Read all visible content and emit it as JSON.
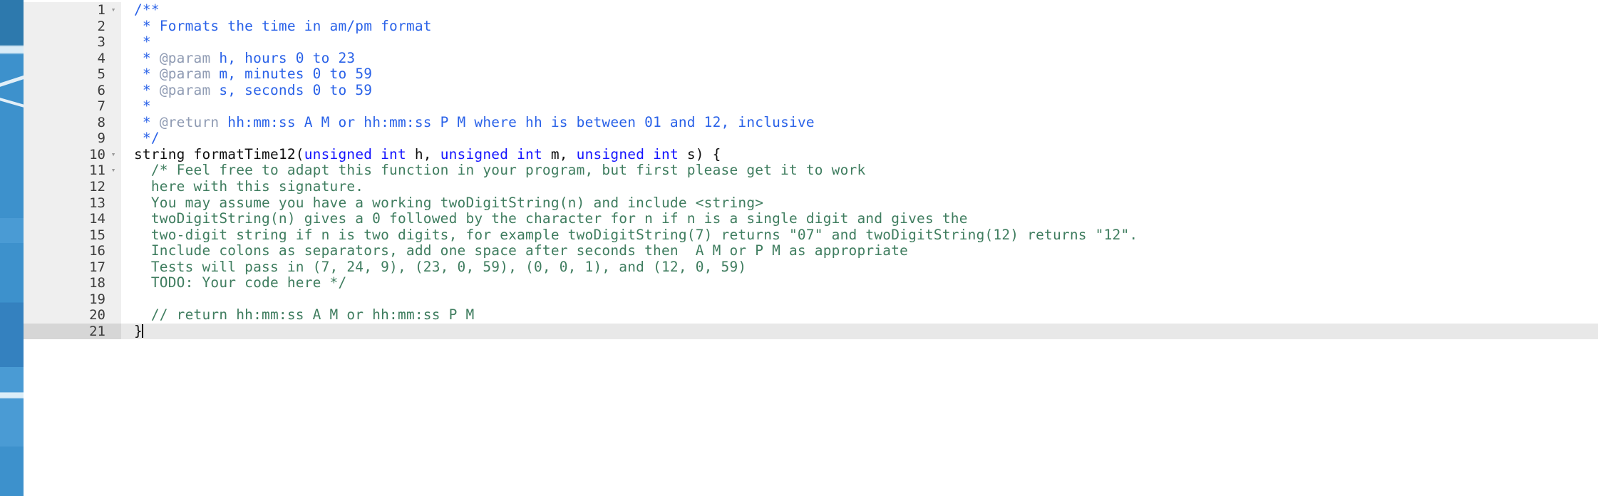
{
  "window": {
    "kind": "code-editor",
    "language": "C++",
    "active_line": 21,
    "total_lines": 21
  },
  "colors": {
    "background": "#ffffff",
    "gutter_background": "#efefef",
    "gutter_active_background": "#d6d6d6",
    "active_line_background": "#e8e8e8",
    "doc_comment": "#2a62e8",
    "doc_tag": "#8f9bb3",
    "block_comment": "#3f7d5f",
    "keyword": "#1414ff",
    "plain_text": "#101010",
    "desktop_accent": "#3d91cc"
  },
  "gutter": {
    "fold_glyph": "▾",
    "numbers": [
      "1",
      "2",
      "3",
      "4",
      "5",
      "6",
      "7",
      "8",
      "9",
      "10",
      "11",
      "12",
      "13",
      "14",
      "15",
      "16",
      "17",
      "18",
      "19",
      "20",
      "21"
    ],
    "foldable_lines": [
      1,
      10,
      11
    ]
  },
  "code": {
    "lines": [
      {
        "n": "1",
        "fold": true,
        "tokens": [
          {
            "t": "doc",
            "s": "/**"
          }
        ]
      },
      {
        "n": "2",
        "fold": false,
        "tokens": [
          {
            "t": "doc",
            "s": " * Formats the time in am/pm format"
          }
        ]
      },
      {
        "n": "3",
        "fold": false,
        "tokens": [
          {
            "t": "doc",
            "s": " *"
          }
        ]
      },
      {
        "n": "4",
        "fold": false,
        "tokens": [
          {
            "t": "doc",
            "s": " * "
          },
          {
            "t": "tag",
            "s": "@param"
          },
          {
            "t": "doc",
            "s": " h, hours 0 to 23"
          }
        ]
      },
      {
        "n": "5",
        "fold": false,
        "tokens": [
          {
            "t": "doc",
            "s": " * "
          },
          {
            "t": "tag",
            "s": "@param"
          },
          {
            "t": "doc",
            "s": " m, minutes 0 to 59"
          }
        ]
      },
      {
        "n": "6",
        "fold": false,
        "tokens": [
          {
            "t": "doc",
            "s": " * "
          },
          {
            "t": "tag",
            "s": "@param"
          },
          {
            "t": "doc",
            "s": " s, seconds 0 to 59"
          }
        ]
      },
      {
        "n": "7",
        "fold": false,
        "tokens": [
          {
            "t": "doc",
            "s": " *"
          }
        ]
      },
      {
        "n": "8",
        "fold": false,
        "tokens": [
          {
            "t": "doc",
            "s": " * "
          },
          {
            "t": "tag",
            "s": "@return"
          },
          {
            "t": "doc",
            "s": " hh:mm:ss A M or hh:mm:ss P M where hh is between 01 and 12, inclusive"
          }
        ]
      },
      {
        "n": "9",
        "fold": false,
        "tokens": [
          {
            "t": "doc",
            "s": " */"
          }
        ]
      },
      {
        "n": "10",
        "fold": true,
        "tokens": [
          {
            "t": "plain",
            "s": "string formatTime12("
          },
          {
            "t": "keyword",
            "s": "unsigned int"
          },
          {
            "t": "plain",
            "s": " h, "
          },
          {
            "t": "keyword",
            "s": "unsigned int"
          },
          {
            "t": "plain",
            "s": " m, "
          },
          {
            "t": "keyword",
            "s": "unsigned int"
          },
          {
            "t": "plain",
            "s": " s) {"
          }
        ]
      },
      {
        "n": "11",
        "fold": true,
        "tokens": [
          {
            "t": "comment",
            "s": "  /* Feel free to adapt this function in your program, but first please get it to work"
          }
        ]
      },
      {
        "n": "12",
        "fold": false,
        "tokens": [
          {
            "t": "comment",
            "s": "  here with this signature."
          }
        ]
      },
      {
        "n": "13",
        "fold": false,
        "tokens": [
          {
            "t": "comment",
            "s": "  You may assume you have a working twoDigitString(n) and include <string>"
          }
        ]
      },
      {
        "n": "14",
        "fold": false,
        "tokens": [
          {
            "t": "comment",
            "s": "  twoDigitString(n) gives a 0 followed by the character for n if n is a single digit and gives the"
          }
        ]
      },
      {
        "n": "15",
        "fold": false,
        "tokens": [
          {
            "t": "comment",
            "s": "  two-digit string if n is two digits, for example twoDigitString(7) returns \"07\" and twoDigitString(12) returns \"12\"."
          }
        ]
      },
      {
        "n": "16",
        "fold": false,
        "tokens": [
          {
            "t": "comment",
            "s": "  Include colons as separators, add one space after seconds then  A M or P M as appropriate"
          }
        ]
      },
      {
        "n": "17",
        "fold": false,
        "tokens": [
          {
            "t": "comment",
            "s": "  Tests will pass in (7, 24, 9), (23, 0, 59), (0, 0, 1), and (12, 0, 59)"
          }
        ]
      },
      {
        "n": "18",
        "fold": false,
        "tokens": [
          {
            "t": "comment",
            "s": "  TODO: Your code here */"
          }
        ]
      },
      {
        "n": "19",
        "fold": false,
        "tokens": [
          {
            "t": "plain",
            "s": ""
          }
        ]
      },
      {
        "n": "20",
        "fold": false,
        "tokens": [
          {
            "t": "comment",
            "s": "  // return hh:mm:ss A M or hh:mm:ss P M"
          }
        ]
      },
      {
        "n": "21",
        "fold": false,
        "active": true,
        "caret": true,
        "tokens": [
          {
            "t": "plain",
            "s": "}"
          }
        ]
      }
    ]
  }
}
